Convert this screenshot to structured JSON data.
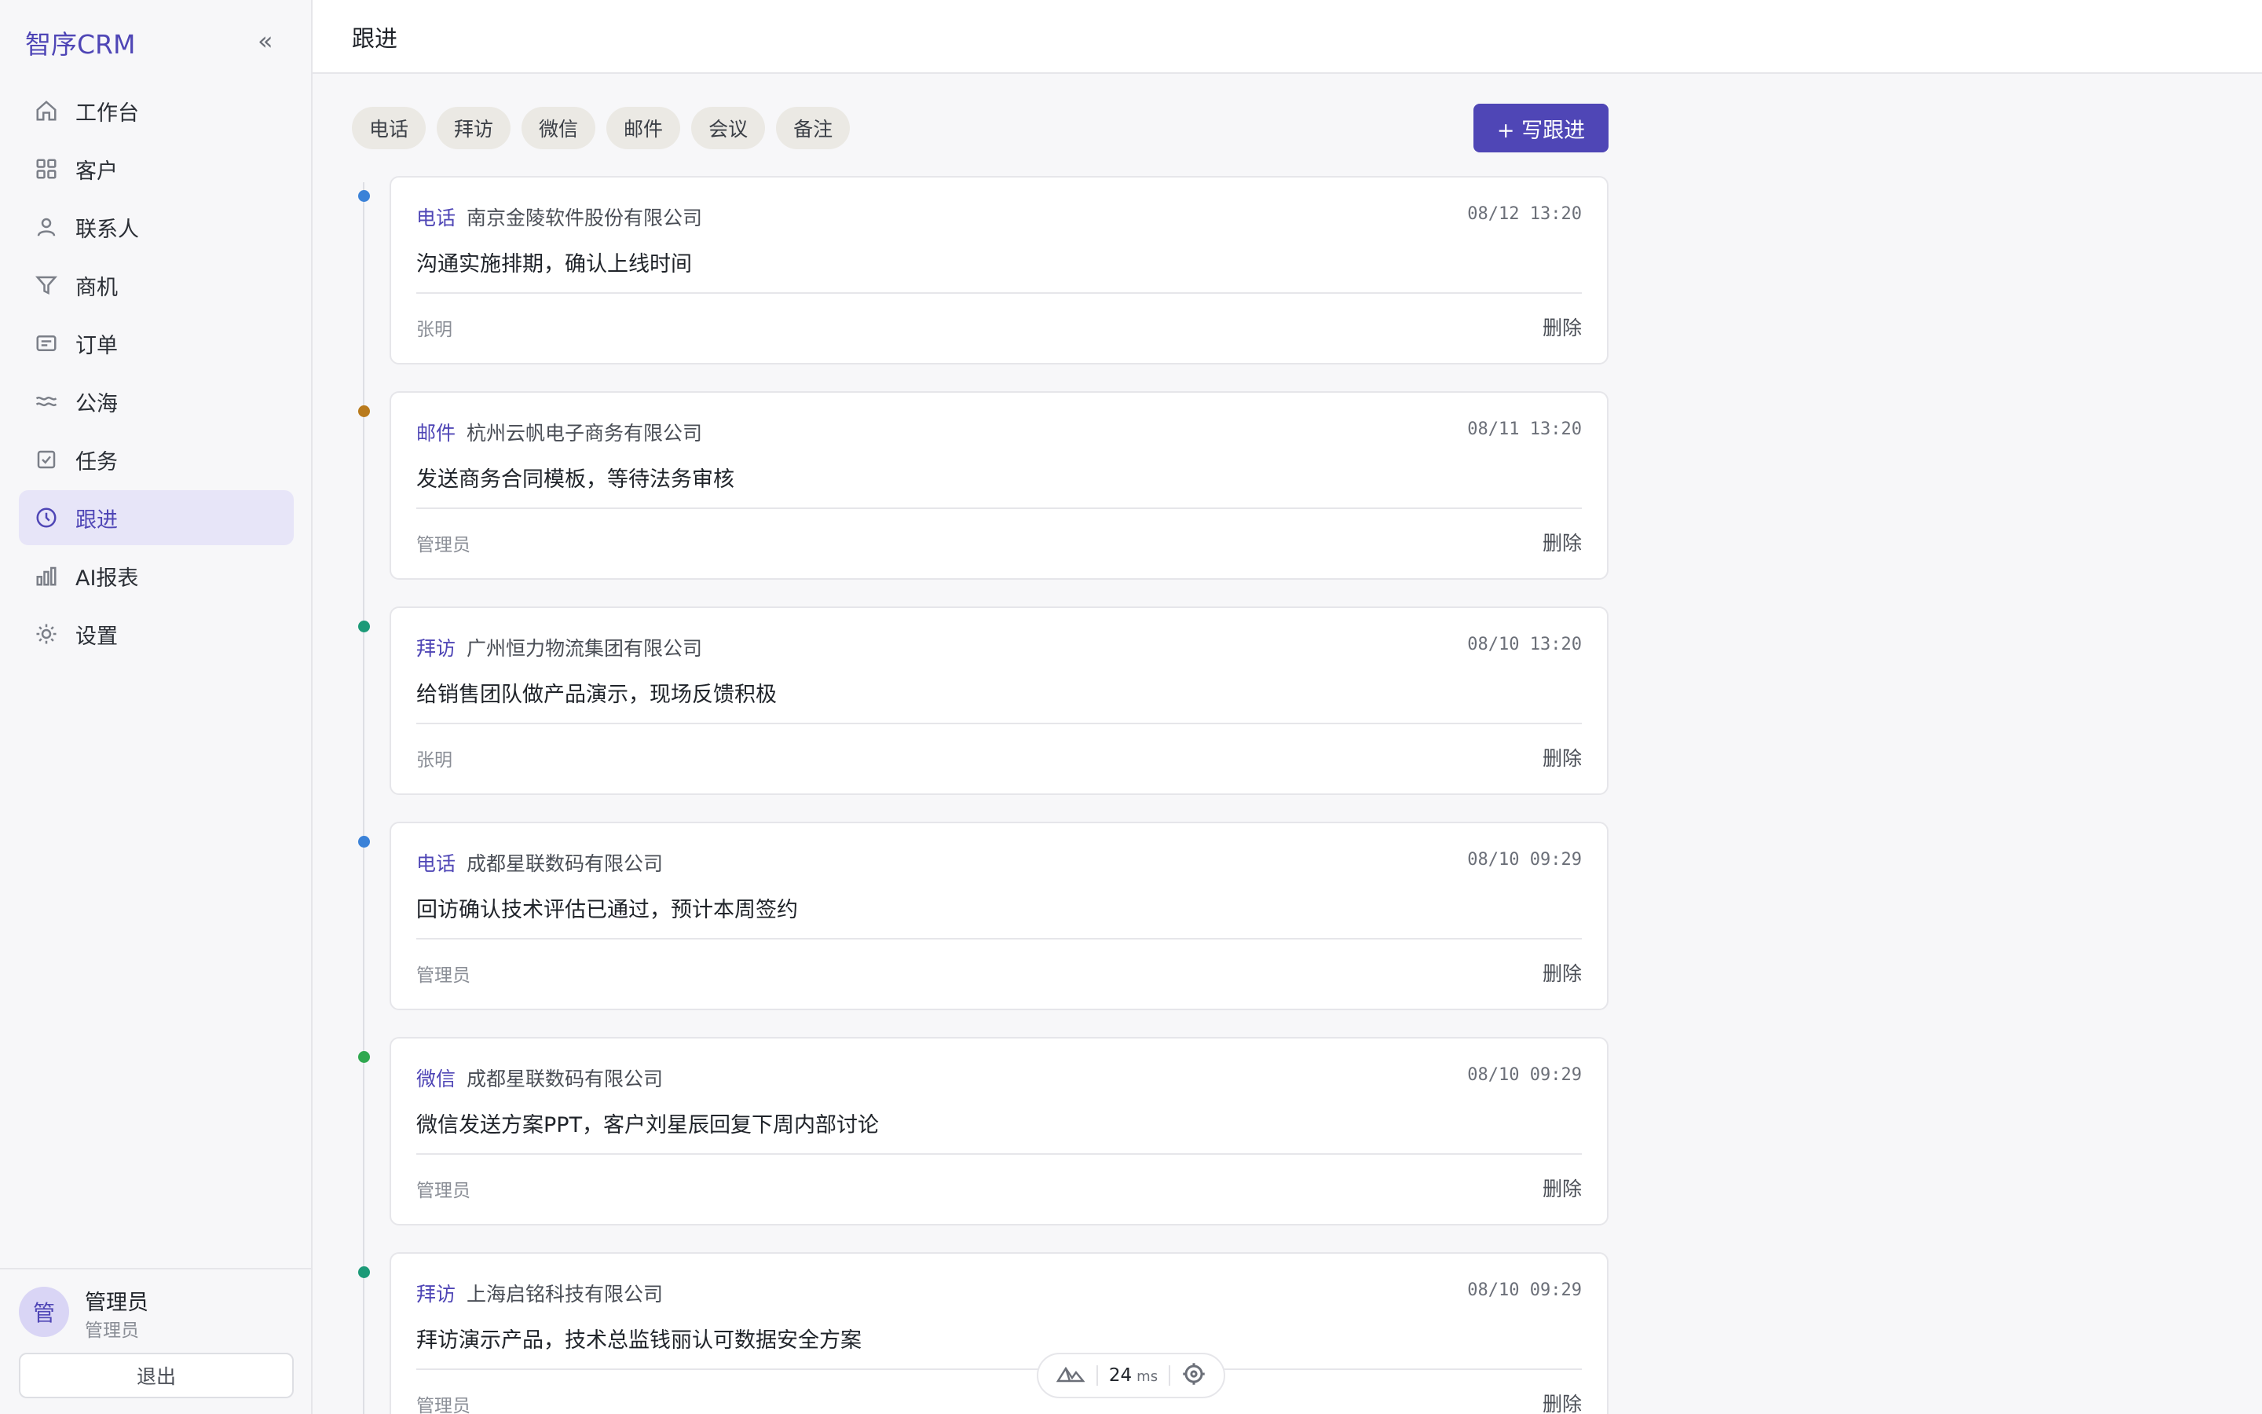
{
  "app": {
    "brand": "智序CRM",
    "collapse_glyph": "«"
  },
  "sidebar": {
    "items": [
      {
        "label": "工作台",
        "icon": "home-icon"
      },
      {
        "label": "客户",
        "icon": "grid-icon"
      },
      {
        "label": "联系人",
        "icon": "user-icon"
      },
      {
        "label": "商机",
        "icon": "funnel-icon"
      },
      {
        "label": "订单",
        "icon": "receipt-icon"
      },
      {
        "label": "公海",
        "icon": "waves-icon"
      },
      {
        "label": "任务",
        "icon": "checkbox-icon"
      },
      {
        "label": "跟进",
        "icon": "clock-icon",
        "active": true
      },
      {
        "label": "AI报表",
        "icon": "bar-chart-icon"
      },
      {
        "label": "设置",
        "icon": "sun-gear-icon"
      }
    ],
    "user": {
      "avatar_text": "管",
      "name": "管理员",
      "role": "管理员",
      "logout_label": "退出"
    }
  },
  "header": {
    "title": "跟进"
  },
  "filters": [
    "电话",
    "拜访",
    "微信",
    "邮件",
    "会议",
    "备注"
  ],
  "write_button_label": "+ 写跟进",
  "type_colors": {
    "电话": "#3b82d8",
    "邮件": "#b97a1c",
    "拜访": "#1c9a78",
    "微信": "#2fa84f"
  },
  "accent_color": "#4f46b6",
  "entries": [
    {
      "type": "电话",
      "company": "南京金陵软件股份有限公司",
      "time": "08/12 13:20",
      "content": "沟通实施排期，确认上线时间",
      "owner": "张明",
      "delete_label": "删除"
    },
    {
      "type": "邮件",
      "company": "杭州云帆电子商务有限公司",
      "time": "08/11 13:20",
      "content": "发送商务合同模板，等待法务审核",
      "owner": "管理员",
      "delete_label": "删除"
    },
    {
      "type": "拜访",
      "company": "广州恒力物流集团有限公司",
      "time": "08/10 13:20",
      "content": "给销售团队做产品演示，现场反馈积极",
      "owner": "张明",
      "delete_label": "删除"
    },
    {
      "type": "电话",
      "company": "成都星联数码有限公司",
      "time": "08/10 09:29",
      "content": "回访确认技术评估已通过，预计本周签约",
      "owner": "管理员",
      "delete_label": "删除"
    },
    {
      "type": "微信",
      "company": "成都星联数码有限公司",
      "time": "08/10 09:29",
      "content": "微信发送方案PPT，客户刘星辰回复下周内部讨论",
      "owner": "管理员",
      "delete_label": "删除"
    },
    {
      "type": "拜访",
      "company": "上海启铭科技有限公司",
      "time": "08/10 09:29",
      "content": "拜访演示产品，技术总监钱丽认可数据安全方案",
      "owner": "管理员",
      "delete_label": "删除"
    }
  ],
  "perf": {
    "value": "24",
    "unit": "ms",
    "logo_icon": "mountain-logo-icon",
    "target_icon": "crosshair-icon"
  }
}
